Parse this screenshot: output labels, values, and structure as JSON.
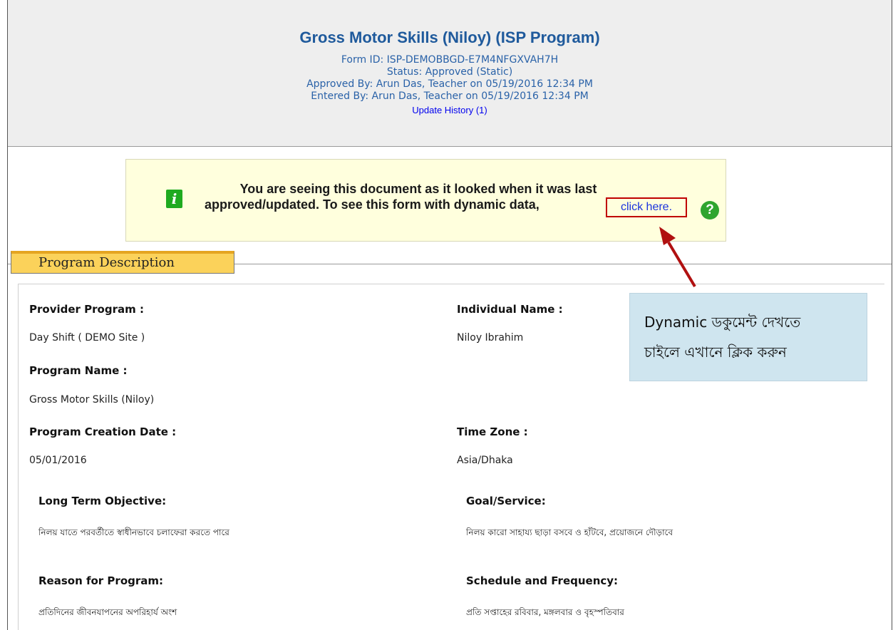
{
  "header": {
    "title": "Gross Motor Skills (Niloy) (ISP Program)",
    "form_id": "Form ID: ISP-DEMOBBGD-E7M4NFGXVAH7H",
    "status": "Status:  Approved (Static)",
    "approved_by": "Approved By: Arun Das, Teacher on 05/19/2016 12:34 PM",
    "entered_by": "Entered By: Arun Das, Teacher  on 05/19/2016 12:34 PM",
    "update_history": "Update History  (1)"
  },
  "notice": {
    "line1": "You are seeing this document as it looked when it was last",
    "line2": "approved/updated. To see this form with dynamic data,",
    "link": "click here.",
    "info_icon": "i",
    "help_icon": "?"
  },
  "section": {
    "title": "Program Description"
  },
  "fields": {
    "provider_program_label": "Provider Program :",
    "provider_program_value": "Day Shift ( DEMO Site )",
    "individual_name_label": "Individual Name :",
    "individual_name_value": "Niloy Ibrahim",
    "program_name_label": "Program Name :",
    "program_name_value": "Gross Motor Skills (Niloy)",
    "creation_date_label": "Program Creation Date :",
    "creation_date_value": "05/01/2016",
    "time_zone_label": "Time Zone :",
    "time_zone_value": "Asia/Dhaka",
    "long_term_label": "Long Term Objective:",
    "long_term_value": "নিলয় যাতে পরবর্তীতে স্বাধীনভাবে চলাফেরা করতে পারে",
    "goal_label": "Goal/Service:",
    "goal_value": "নিলয় কারো সাহায্য ছাড়া বসবে ও হাঁটবে, প্রয়োজনে দৌড়াবে",
    "reason_label": "Reason for Program:",
    "reason_value": "প্রতিদিনের জীবনযাপনের অপরিহার্য অংশ",
    "schedule_label": "Schedule and Frequency:",
    "schedule_value": "প্রতি সপ্তাহের রবিবার, মঙ্গলবার ও বৃহস্পতিবার"
  },
  "callout": {
    "line1": "Dynamic ডকুমেন্ট  দেখতে",
    "line2": "চাইলে এখানে ক্লিক  করুন"
  },
  "colors": {
    "title_blue": "#1f5a9c",
    "link_blue": "#0000ee",
    "notice_bg": "#ffffdd",
    "section_tab": "#fbd25a",
    "callout_bg": "#cfe5ef",
    "highlight_red": "#c00000",
    "success_green": "#2fa52f"
  }
}
